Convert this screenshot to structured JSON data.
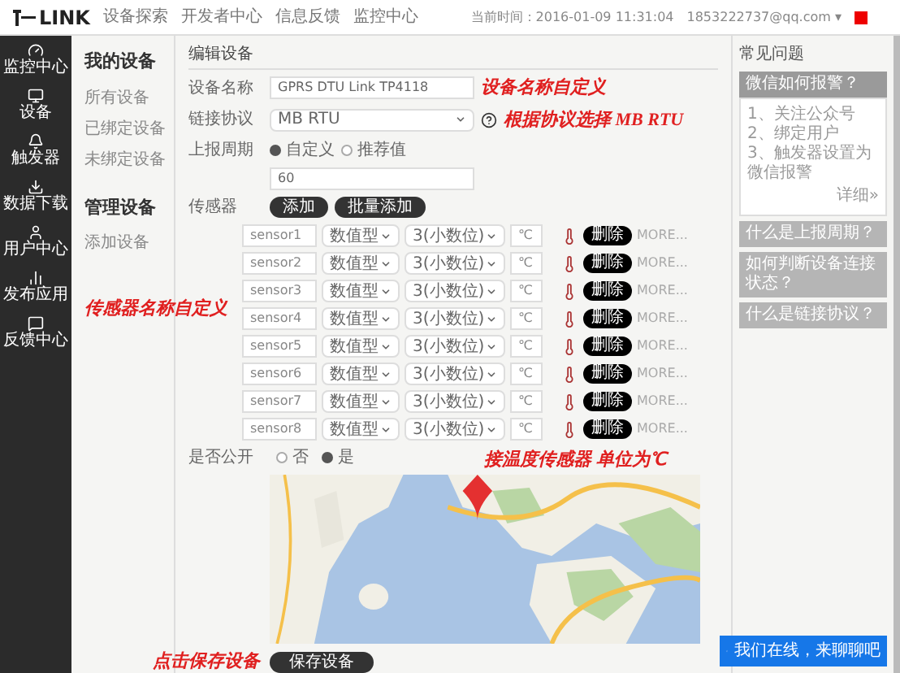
{
  "header": {
    "logo": "LINK",
    "nav": [
      "设备探索",
      "开发者中心",
      "信息反馈",
      "监控中心"
    ],
    "time": "当前时间：2016-01-09 11:31:04",
    "user": "1853222737@qq.com",
    "user_caret": "▾"
  },
  "sidebar": {
    "items": [
      {
        "label": "监控中心"
      },
      {
        "label": "设备"
      },
      {
        "label": "触发器"
      },
      {
        "label": "数据下载"
      },
      {
        "label": "用户中心"
      },
      {
        "label": "发布应用"
      },
      {
        "label": "反馈中心"
      }
    ]
  },
  "sub_sidebar": {
    "sections": [
      {
        "title": "我的设备",
        "items": [
          "所有设备",
          "已绑定设备",
          "未绑定设备"
        ]
      },
      {
        "title": "管理设备",
        "items": [
          "添加设备"
        ]
      }
    ]
  },
  "form": {
    "title": "编辑设备",
    "name_label": "设备名称",
    "name_value": "GPRS DTU Link TP4118",
    "protocol_label": "链接协议",
    "protocol_value": "MB RTU",
    "period_label": "上报周期",
    "period_options": [
      {
        "label": "自定义",
        "selected": true
      },
      {
        "label": "推荐值",
        "selected": false
      }
    ],
    "period_value": "60",
    "sensors_label": "传感器",
    "sensor_buttons": [
      "添加",
      "批量添加"
    ],
    "sensors": [
      {
        "name": "sensor1",
        "type": "数值型",
        "decimals": "3(小数位)",
        "unit": "℃",
        "button": "删除",
        "more": "MORE..."
      },
      {
        "name": "sensor2",
        "type": "数值型",
        "decimals": "3(小数位)",
        "unit": "℃",
        "button": "删除",
        "more": "MORE..."
      },
      {
        "name": "sensor3",
        "type": "数值型",
        "decimals": "3(小数位)",
        "unit": "℃",
        "button": "删除",
        "more": "MORE..."
      },
      {
        "name": "sensor4",
        "type": "数值型",
        "decimals": "3(小数位)",
        "unit": "℃",
        "button": "删除",
        "more": "MORE..."
      },
      {
        "name": "sensor5",
        "type": "数值型",
        "decimals": "3(小数位)",
        "unit": "℃",
        "button": "删除",
        "more": "MORE..."
      },
      {
        "name": "sensor6",
        "type": "数值型",
        "decimals": "3(小数位)",
        "unit": "℃",
        "button": "删除",
        "more": "MORE..."
      },
      {
        "name": "sensor7",
        "type": "数值型",
        "decimals": "3(小数位)",
        "unit": "℃",
        "button": "删除",
        "more": "MORE..."
      },
      {
        "name": "sensor8",
        "type": "数值型",
        "decimals": "3(小数位)",
        "unit": "℃",
        "button": "删除",
        "more": "MORE..."
      }
    ],
    "public_label": "是否公开",
    "public_options": [
      {
        "label": "否",
        "selected": false
      },
      {
        "label": "是",
        "selected": true
      }
    ],
    "map": {
      "kind": "picture"
    },
    "save_button": "保存设备"
  },
  "annotations": {
    "name": "设备名称自定义",
    "protocol": "根据协议选择 MB RTU",
    "sensors": "传感器名称自定义",
    "unit": "接温度传感器 单位为℃",
    "save": "点击保存设备"
  },
  "faq": {
    "title": "常见问题",
    "items": [
      {
        "title": "微信如何报警？",
        "expanded": true,
        "body": [
          "1、关注公众号",
          "2、绑定用户",
          "3、触发器设置为微信报警"
        ],
        "link": "详细»"
      },
      {
        "title": "什么是上报周期？",
        "expanded": false
      },
      {
        "title": "如何判断设备连接状态？",
        "expanded": false
      },
      {
        "title": "什么是链接协议？",
        "expanded": false
      }
    ]
  },
  "chat": {
    "label": "我们在线，来聊聊吧"
  }
}
